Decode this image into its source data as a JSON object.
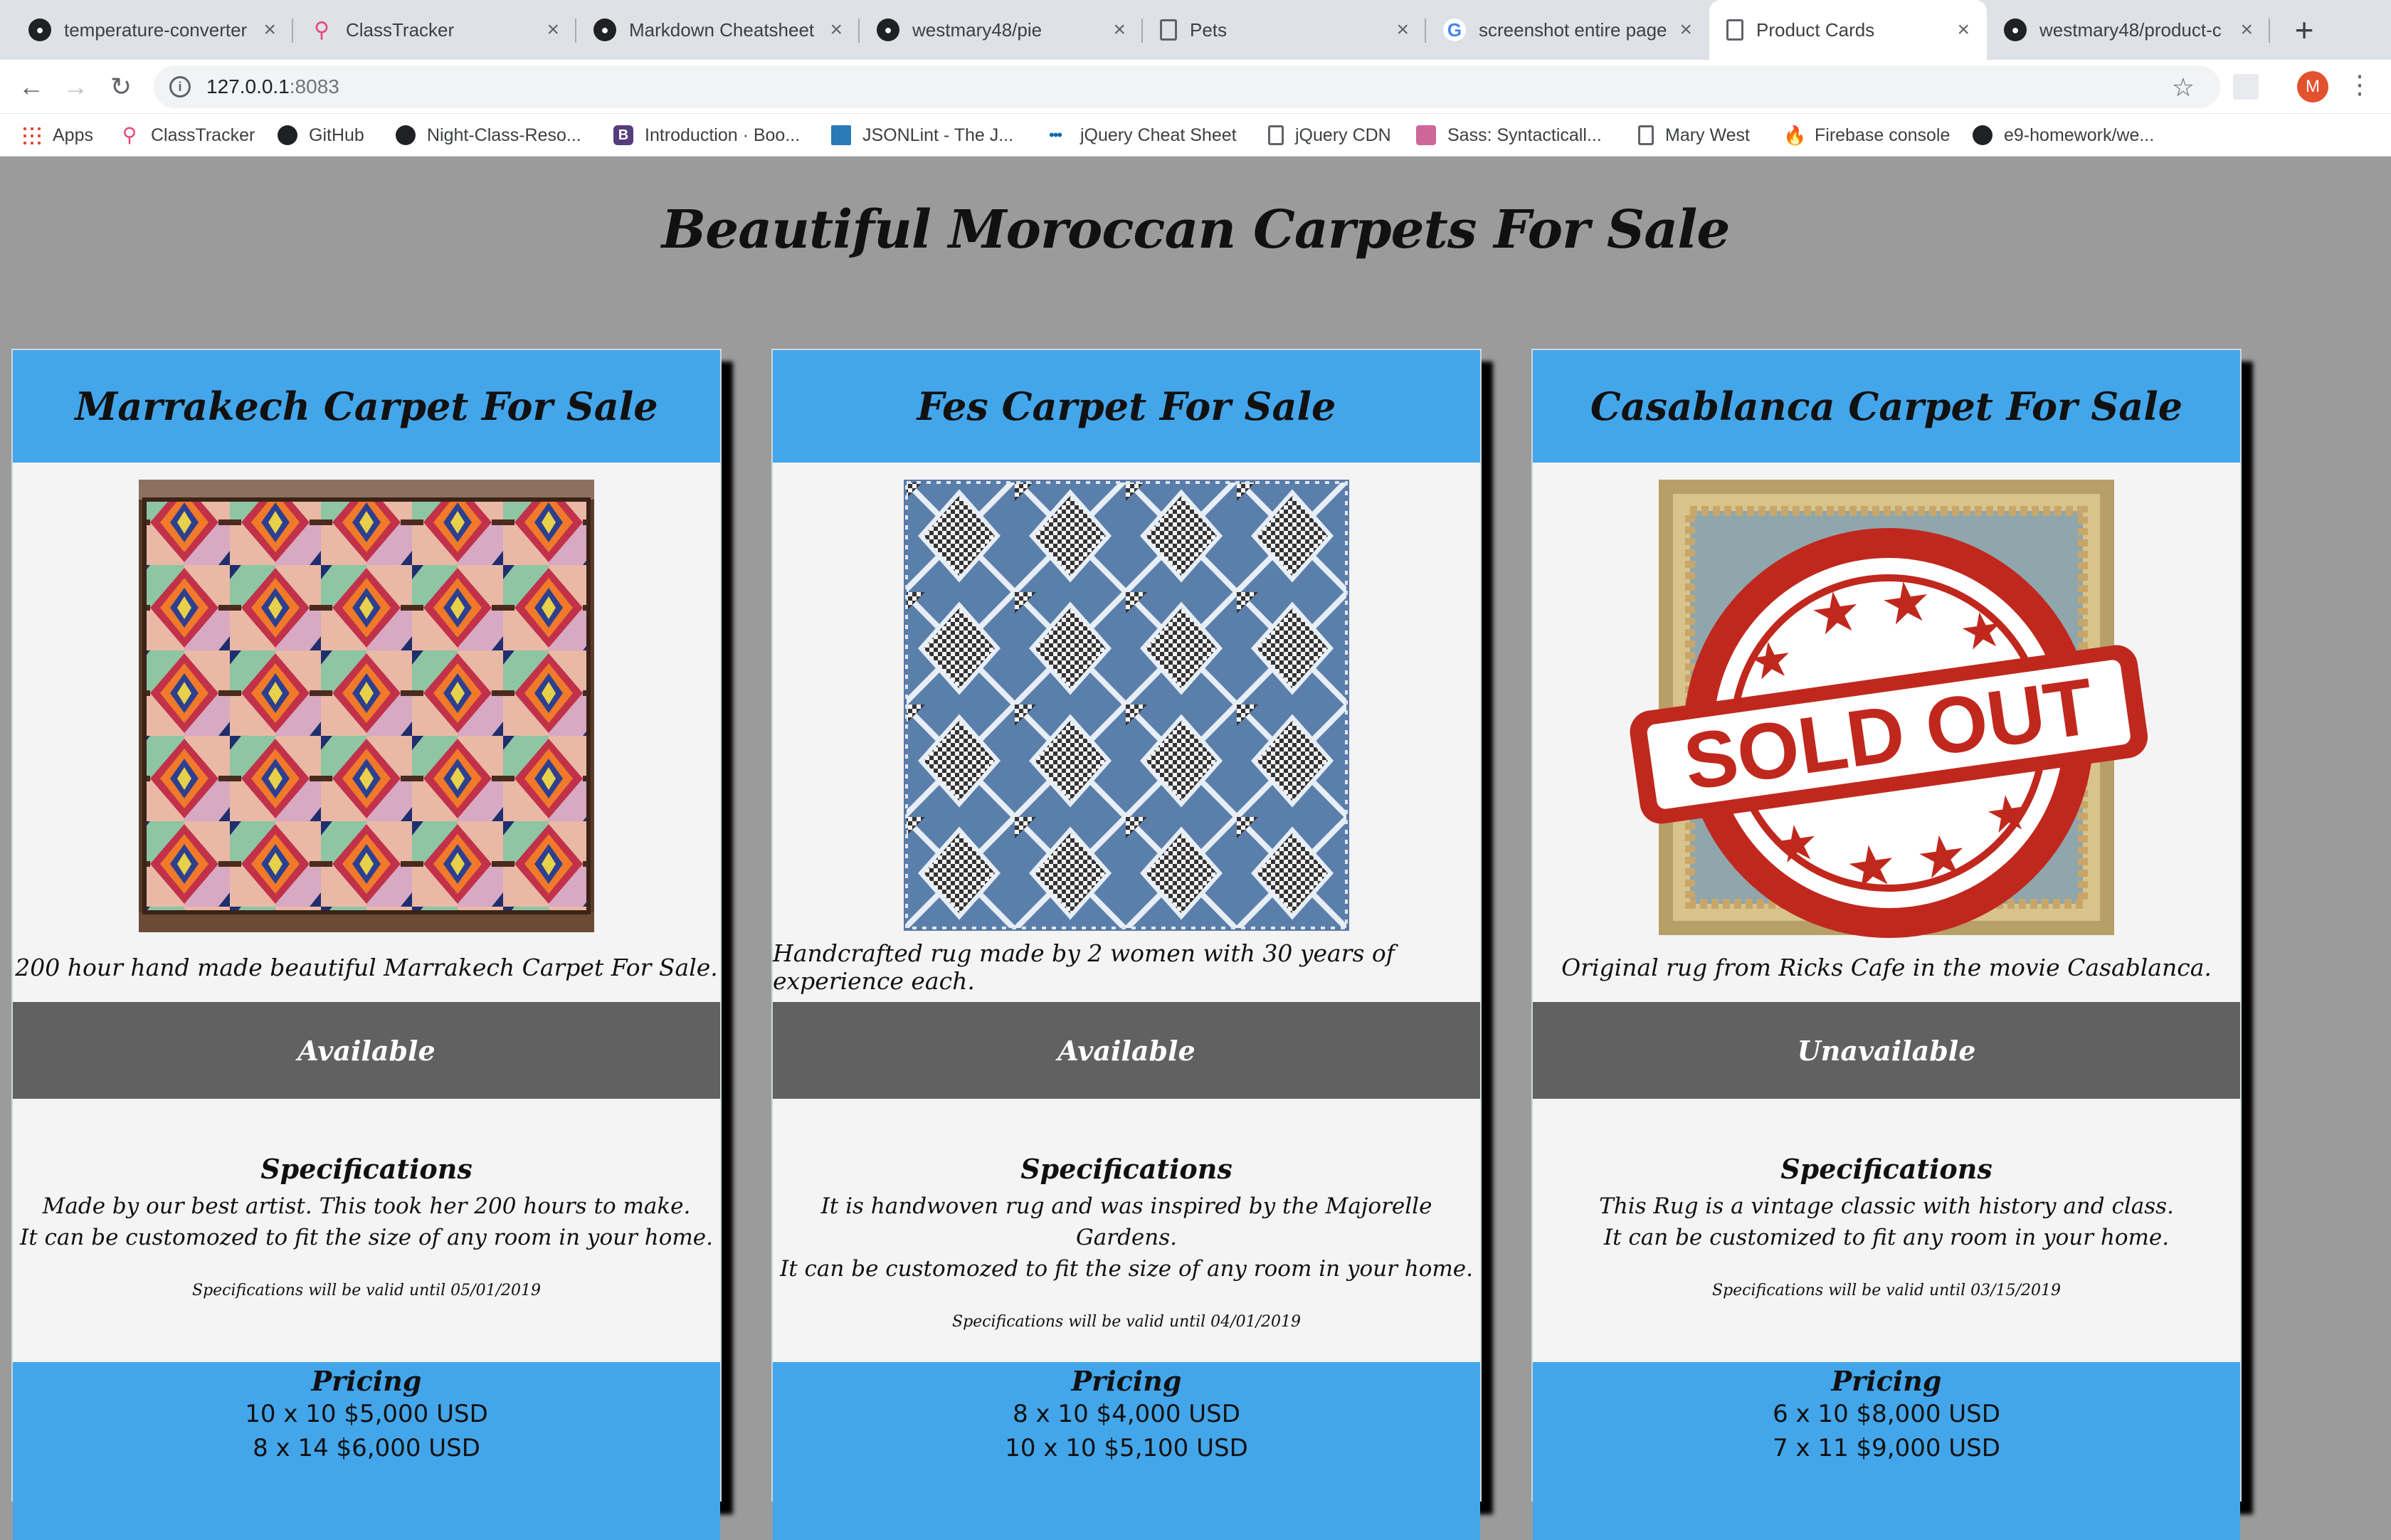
{
  "browser": {
    "tabs": [
      {
        "title": "temperature-converter",
        "icon": "github-icon"
      },
      {
        "title": "ClassTracker",
        "icon": "classtracker-icon"
      },
      {
        "title": "Markdown Cheatsheet",
        "icon": "github-icon"
      },
      {
        "title": "westmary48/pie",
        "icon": "github-icon"
      },
      {
        "title": "Pets",
        "icon": "document-icon"
      },
      {
        "title": "screenshot entire page",
        "icon": "google-icon"
      },
      {
        "title": "Product Cards",
        "icon": "document-icon",
        "active": true
      },
      {
        "title": "westmary48/product-c",
        "icon": "github-icon"
      }
    ],
    "url_host": "127.0.0.1",
    "url_port": ":8083",
    "avatar_letter": "M",
    "bookmarks": [
      {
        "label": "Apps",
        "icon": "apps-grid-icon"
      },
      {
        "label": "ClassTracker",
        "icon": "classtracker-icon"
      },
      {
        "label": "GitHub",
        "icon": "github-icon"
      },
      {
        "label": "Night-Class-Reso...",
        "icon": "github-icon"
      },
      {
        "label": "Introduction · Boo...",
        "icon": "bootstrap-icon"
      },
      {
        "label": "JSONLint - The J...",
        "icon": "jsonlint-icon"
      },
      {
        "label": "jQuery Cheat Sheet",
        "icon": "jquery-icon"
      },
      {
        "label": "jQuery CDN",
        "icon": "document-icon"
      },
      {
        "label": "Sass: Syntacticall...",
        "icon": "sass-icon"
      },
      {
        "label": "Mary West",
        "icon": "document-icon"
      },
      {
        "label": "Firebase console",
        "icon": "firebase-icon"
      },
      {
        "label": "e9-homework/we...",
        "icon": "github-icon"
      }
    ]
  },
  "page": {
    "title": "Beautiful Moroccan Carpets For Sale",
    "cards": [
      {
        "title": "Marrakech Carpet For Sale",
        "description": "200 hour hand made beautiful Marrakech Carpet For Sale.",
        "status": "Available",
        "specs_heading": "Specifications",
        "specs_line1": "Made by our best artist. This took her 200 hours to make.",
        "specs_line2": "It can be customozed to fit the size of any room in your home.",
        "valid_until": "Specifications will be valid until 05/01/2019",
        "pricing_heading": "Pricing",
        "price1": "10 x 10 $5,000 USD",
        "price2": "8 x 14 $6,000 USD",
        "sold_out": false
      },
      {
        "title": "Fes Carpet For Sale",
        "description": "Handcrafted rug made by 2 women with 30 years of experience each.",
        "status": "Available",
        "specs_heading": "Specifications",
        "specs_line1": "It is handwoven rug and was inspired by the Majorelle Gardens.",
        "specs_line2": "It can be customozed to fit the size of any room in your home.",
        "valid_until": "Specifications will be valid until 04/01/2019",
        "pricing_heading": "Pricing",
        "price1": "8 x 10 $4,000 USD",
        "price2": "10 x 10 $5,100 USD",
        "sold_out": false
      },
      {
        "title": "Casablanca Carpet For Sale",
        "description": "Original rug from Ricks Cafe in the movie Casablanca.",
        "status": "Unavailable",
        "specs_heading": "Specifications",
        "specs_line1": "This Rug is a vintage classic with history and class.",
        "specs_line2": "It can be customized to fit any room in your home.",
        "valid_until": "Specifications will be valid until 03/15/2019",
        "pricing_heading": "Pricing",
        "price1": "6 x 10 $8,000 USD",
        "price2": "7 x 11 $9,000 USD",
        "sold_out": true,
        "stamp_text": "SOLD OUT"
      }
    ]
  },
  "colors": {
    "card_header": "#44a6ea",
    "status_bar": "#616161",
    "page_bg": "#9b9b9b",
    "stamp_red": "#c0281e"
  }
}
